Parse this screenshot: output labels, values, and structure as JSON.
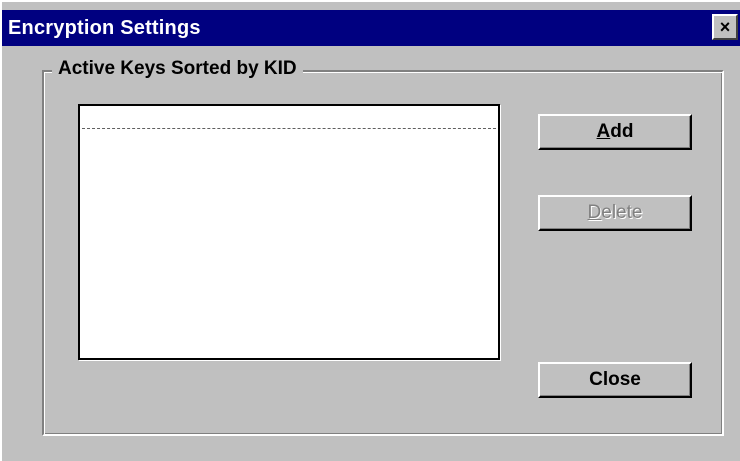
{
  "window": {
    "title": "Encryption Settings",
    "close_glyph": "×"
  },
  "group": {
    "legend": "Active Keys Sorted by KID"
  },
  "keys_list": {
    "items": []
  },
  "buttons": {
    "add_label": "Add",
    "delete_label": "Delete",
    "close_label": "Close",
    "delete_enabled": false
  },
  "colors": {
    "titlebar": "#000080",
    "face": "#c0c0c0",
    "disabled_text": "#808080"
  }
}
